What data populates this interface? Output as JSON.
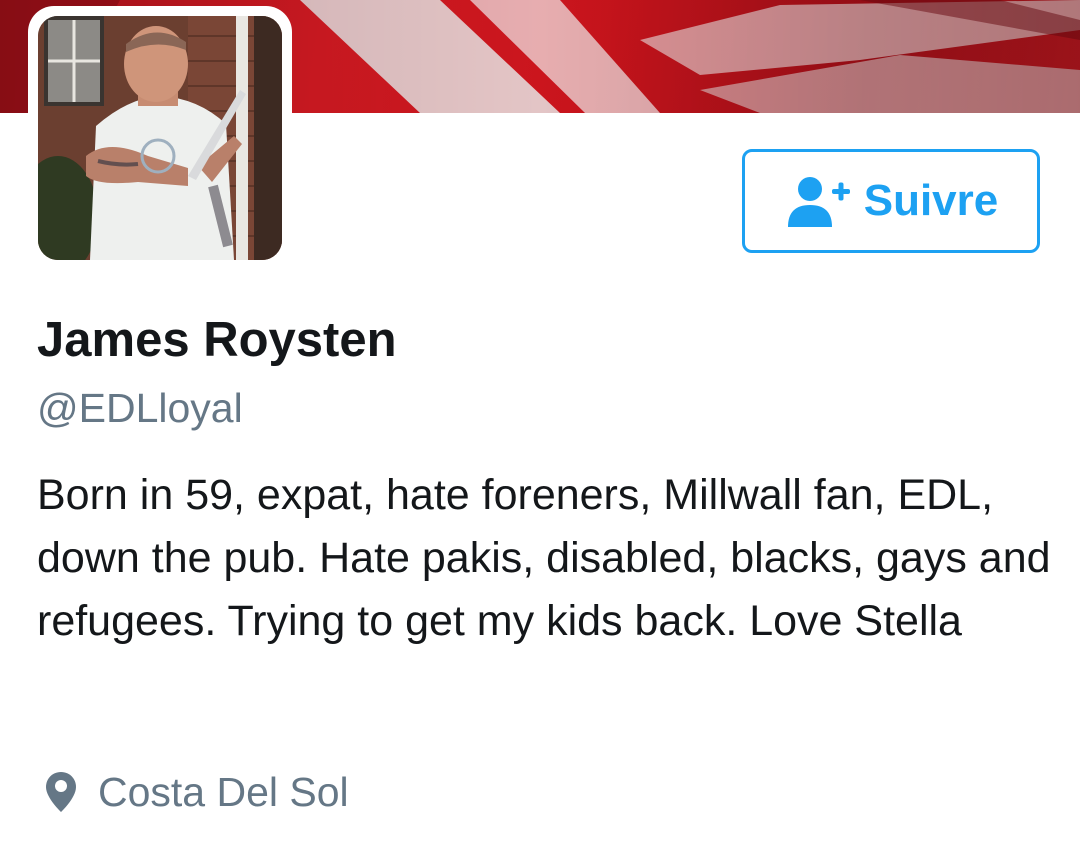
{
  "profile": {
    "name": "James Roysten",
    "handle": "@EDLloyal",
    "bio": "Born in 59, expat, hate foreners, Millwall fan, EDL, down the pub. Hate pakis, disabled, blacks, gays and refugees. Trying to get my kids back. Love Stella",
    "location": "Costa Del Sol"
  },
  "actions": {
    "follow_label": "Suivre",
    "follow_icon": "add-user-icon"
  },
  "icons": {
    "location": "map-pin-icon"
  },
  "colors": {
    "accent": "#1da1f2",
    "secondary_text": "#657786",
    "primary_text": "#14171a",
    "banner": "#c9141c"
  }
}
